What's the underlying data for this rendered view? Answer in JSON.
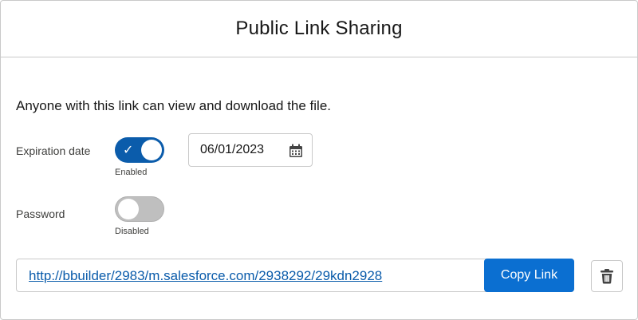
{
  "dialog": {
    "title": "Public Link Sharing",
    "description": "Anyone with this link can view and download the file."
  },
  "expiration": {
    "label": "Expiration date",
    "toggle_state": "on",
    "status": "Enabled",
    "date_value": "06/01/2023",
    "date_icon": "calendar-icon"
  },
  "password": {
    "label": "Password",
    "toggle_state": "off",
    "status": "Disabled"
  },
  "link": {
    "url": "http://bbuilder/2983/m.salesforce.com/2938292/29kdn2928",
    "copy_label": "Copy Link",
    "delete_icon": "trash-icon"
  },
  "colors": {
    "brand_blue": "#0b5cab",
    "button_blue": "#0b6fd1",
    "toggle_off": "#bfbfbf",
    "border": "#c9c9c9"
  }
}
